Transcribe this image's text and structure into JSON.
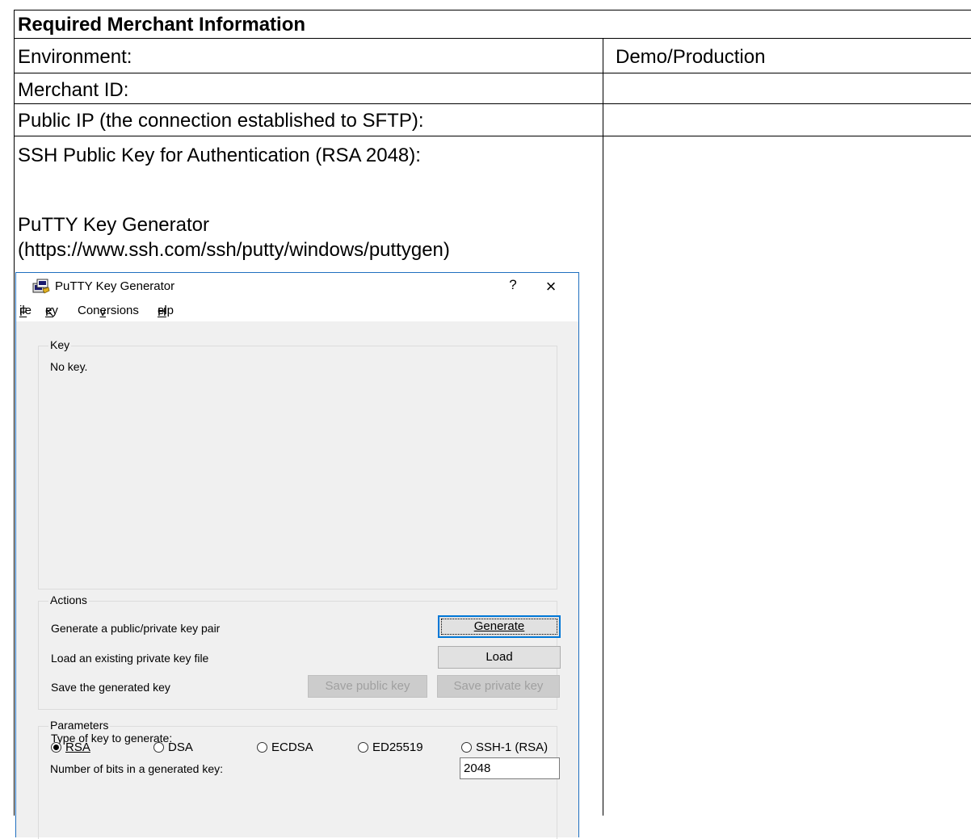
{
  "table": {
    "header": "Required Merchant Information",
    "rows": [
      {
        "label": "Environment:",
        "value": "Demo/Production"
      },
      {
        "label": "Merchant ID:",
        "value": ""
      },
      {
        "label": "Public IP (the connection established to SFTP):",
        "value": ""
      }
    ],
    "ssh_cell": {
      "line1": "SSH Public Key for Authentication (RSA 2048):",
      "line2": "PuTTY Key Generator",
      "line3": "(https://www.ssh.com/ssh/putty/windows/puttygen)"
    }
  },
  "puttygen": {
    "window_title": "PuTTY Key Generator",
    "title_help": "?",
    "title_close": "×",
    "menu": {
      "file": "File",
      "key": "Key",
      "conversions": "Conversions",
      "help": "Help"
    },
    "key_group": {
      "label": "Key",
      "status": "No key."
    },
    "actions": {
      "label": "Actions",
      "generate_text": "Generate a public/private key pair",
      "generate_button": "Generate",
      "load_text": "Load an existing private key file",
      "load_button": "Load",
      "save_text": "Save the generated key",
      "save_public_button": "Save public key",
      "save_private_button": "Save private key"
    },
    "parameters": {
      "label": "Parameters",
      "type_label": "Type of key to generate:",
      "options": [
        "RSA",
        "DSA",
        "ECDSA",
        "ED25519",
        "SSH-1 (RSA)"
      ],
      "selected": "RSA",
      "bits_label": "Number of bits in a generated key:",
      "bits_value": "2048"
    }
  }
}
